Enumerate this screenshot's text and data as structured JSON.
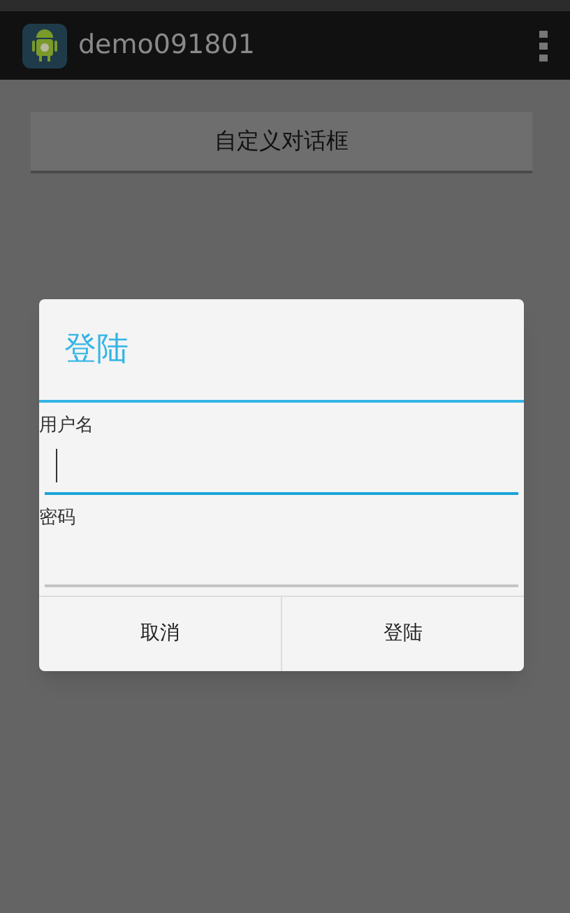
{
  "action_bar": {
    "title": "demo091801"
  },
  "main_button": {
    "label": "自定义对话框"
  },
  "dialog": {
    "title": "登陆",
    "fields": [
      {
        "label": "用户名",
        "focused": true
      },
      {
        "label": "密码",
        "focused": false
      }
    ],
    "buttons": [
      "取消",
      "登陆"
    ]
  }
}
